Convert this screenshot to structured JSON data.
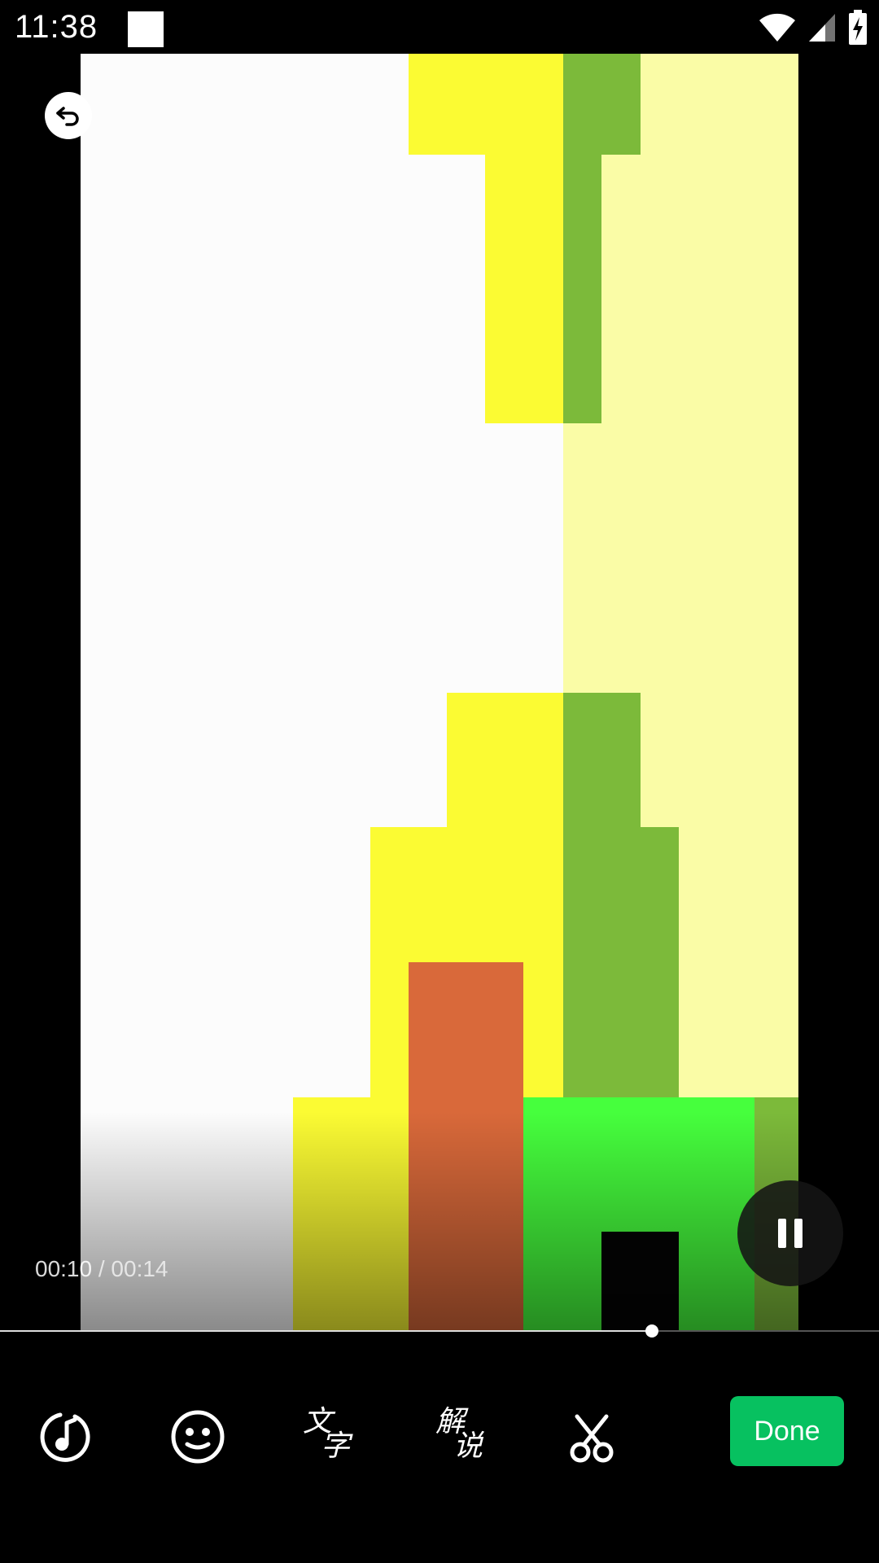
{
  "status_bar": {
    "time": "11:38",
    "icons": [
      "notification-square-icon",
      "wifi-icon",
      "signal-icon",
      "battery-charging-icon"
    ]
  },
  "player": {
    "current_time": "00:10",
    "separator": "/",
    "total_time": "00:14",
    "progress_fraction": 0.742,
    "state": "playing"
  },
  "toolbar": {
    "music_icon": "music-icon",
    "sticker_icon": "sticker-smiley-icon",
    "text_label_1": "文",
    "text_label_2": "字",
    "narration_label_1": "解",
    "narration_label_2": "说",
    "cut_icon": "scissors-icon",
    "done_label": "Done"
  },
  "colors": {
    "accent": "#07c160",
    "video_yellow": "#fbfb33",
    "video_green": "#7cba3a",
    "video_pale_yellow": "#fafca6",
    "video_orange": "#d9693a",
    "video_bright_green": "#46ff3d"
  }
}
